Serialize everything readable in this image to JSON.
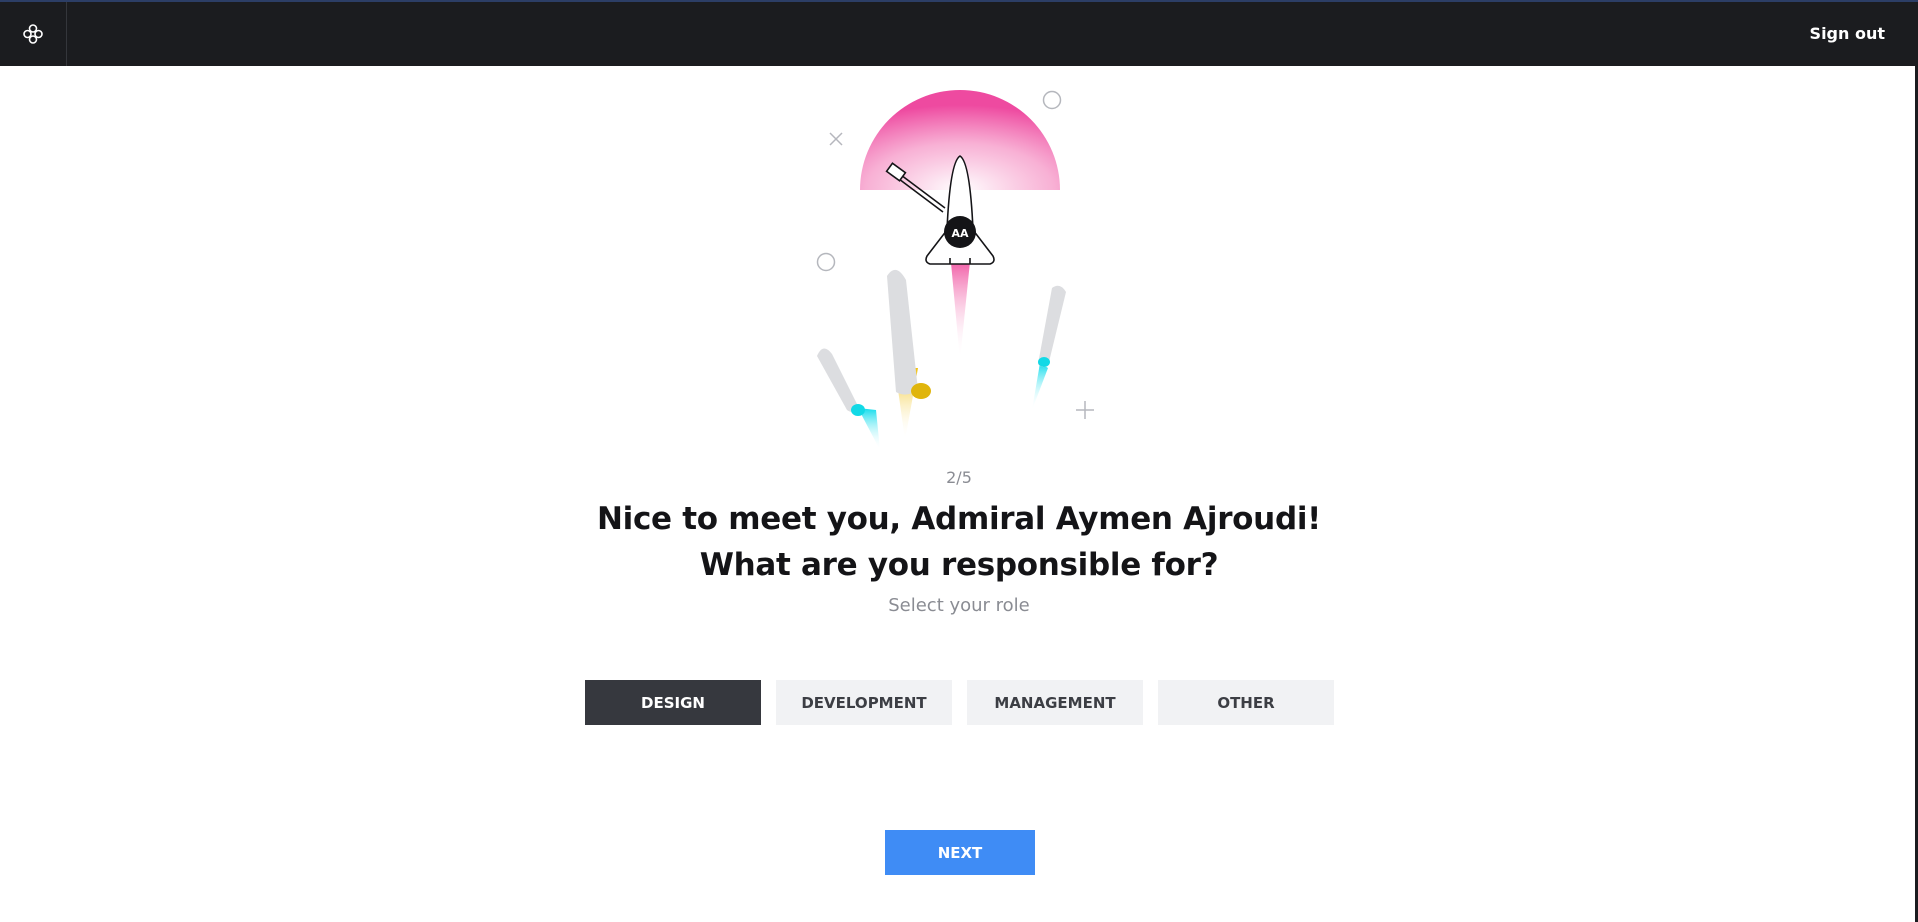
{
  "header": {
    "logo_icon": "app-logo-icon",
    "signout_label": "Sign out"
  },
  "illustration": {
    "avatar_initials": "AA"
  },
  "onboarding": {
    "step": "2/5",
    "heading_line1": "Nice to meet you, Admiral Aymen Ajroudi!",
    "heading_line2": "What are you responsible for?",
    "subtitle": "Select your role"
  },
  "roles": [
    {
      "label": "DESIGN",
      "selected": true
    },
    {
      "label": "DEVELOPMENT",
      "selected": false
    },
    {
      "label": "MANAGEMENT",
      "selected": false
    },
    {
      "label": "OTHER",
      "selected": false
    }
  ],
  "actions": {
    "next_label": "NEXT"
  },
  "colors": {
    "header_bg": "#1b1c1f",
    "selected_role_bg": "#36383e",
    "primary_button": "#3f8cf5",
    "rocket_flame_pink": "#f0509a",
    "flame_cyan": "#18e6f0",
    "flame_yellow": "#f2c418"
  }
}
